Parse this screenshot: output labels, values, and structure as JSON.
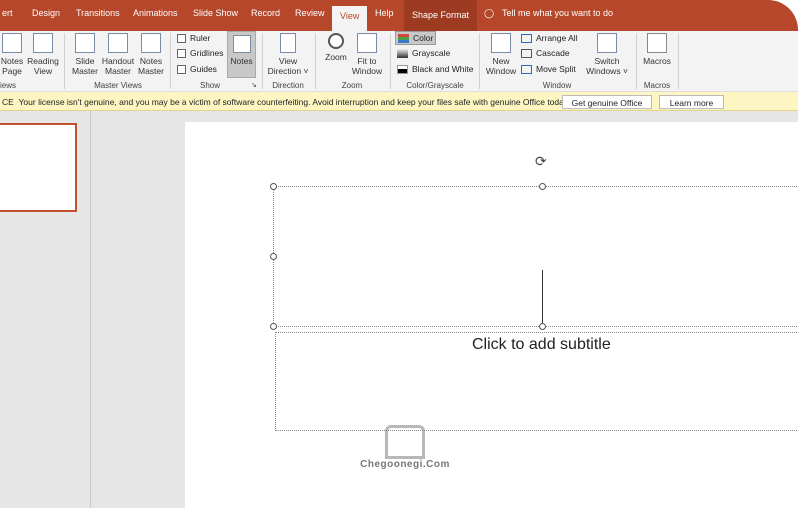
{
  "tabs": [
    {
      "label": "ert"
    },
    {
      "label": "Design"
    },
    {
      "label": "Transitions"
    },
    {
      "label": "Animations"
    },
    {
      "label": "Slide Show"
    },
    {
      "label": "Record"
    },
    {
      "label": "Review"
    },
    {
      "label": "View",
      "active": true
    },
    {
      "label": "Help"
    },
    {
      "label": "Shape Format"
    }
  ],
  "tell_me": "Tell me what you want to do",
  "ribbon": {
    "presentation_views": {
      "group": "iews",
      "buttons": [
        "Notes Page",
        "Reading View"
      ]
    },
    "master_views": {
      "group": "Master Views",
      "buttons": [
        "Slide Master",
        "Handout Master",
        "Notes Master"
      ]
    },
    "show": {
      "group": "Show",
      "checkboxes": [
        {
          "label": "Ruler",
          "checked": false
        },
        {
          "label": "Gridlines",
          "checked": false
        },
        {
          "label": "Guides",
          "checked": false
        }
      ],
      "notes": "Notes"
    },
    "direction": {
      "group": "Direction",
      "button": "View Direction"
    },
    "zoom": {
      "group": "Zoom",
      "buttons": [
        "Zoom",
        "Fit to Window"
      ]
    },
    "color": {
      "group": "Color/Grayscale",
      "options": [
        "Color",
        "Grayscale",
        "Black and White"
      ],
      "selected": "Color"
    },
    "window": {
      "group": "Window",
      "new_window": "New Window",
      "options": [
        "Arrange All",
        "Cascade",
        "Move Split"
      ],
      "switch": "Switch Windows"
    },
    "macros": {
      "group": "Macros",
      "button": "Macros"
    }
  },
  "message": {
    "prefix": "CE",
    "text": "Your license isn't genuine, and you may be a victim of software counterfeiting. Avoid interruption and keep your files safe with genuine Office today.",
    "get": "Get genuine Office",
    "learn": "Learn more"
  },
  "slide": {
    "subtitle_placeholder": "Click to add subtitle"
  },
  "watermark": "Chegoonegi.Com",
  "colors": {
    "accent": "#b7472a",
    "message_bg": "#fdf6c3",
    "thumb_border": "#c0502f"
  }
}
